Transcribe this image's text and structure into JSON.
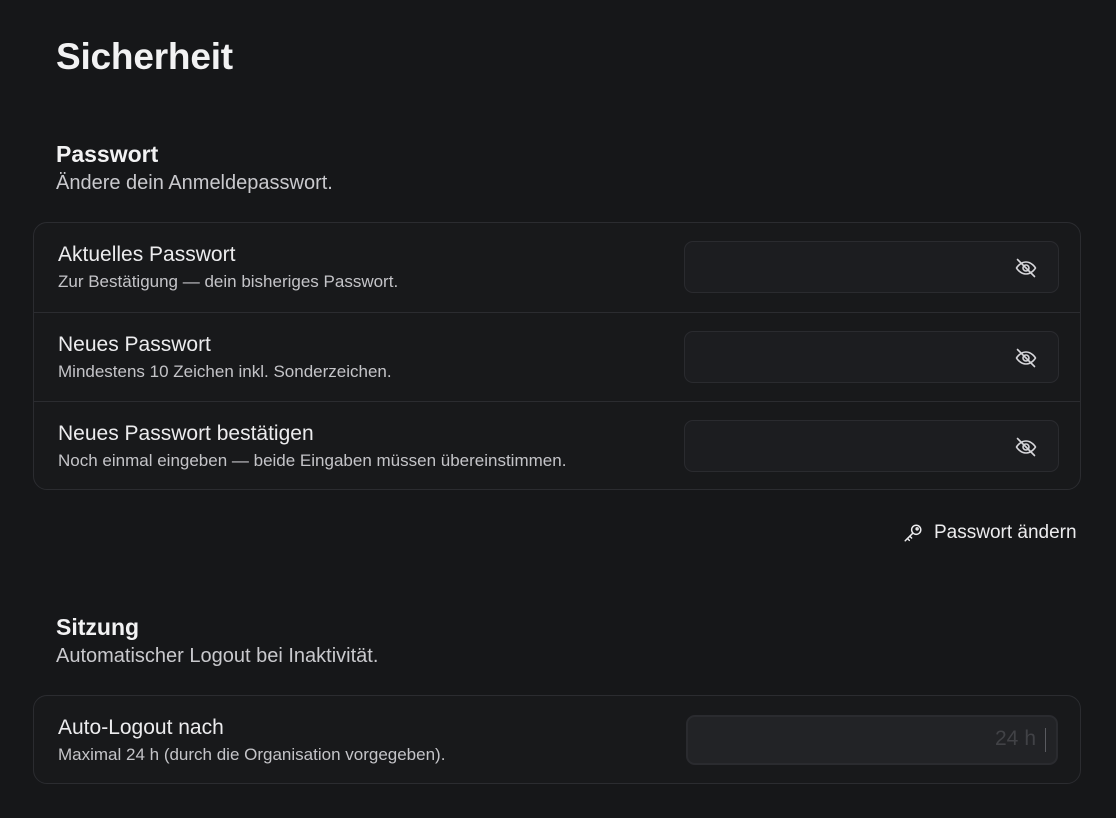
{
  "page": {
    "title": "Sicherheit"
  },
  "password_section": {
    "title": "Passwort",
    "subtitle": "Ändere dein Anmeldepasswort.",
    "rows": [
      {
        "label": "Aktuelles Passwort",
        "description": "Zur Bestätigung — dein bisheriges Passwort.",
        "value": "",
        "icon": "eye-off-icon"
      },
      {
        "label": "Neues Passwort",
        "description": "Mindestens 10 Zeichen inkl. Sonderzeichen.",
        "value": "",
        "icon": "eye-off-icon"
      },
      {
        "label": "Neues Passwort bestätigen",
        "description": "Noch einmal eingeben — beide Eingaben müssen übereinstimmen.",
        "value": "",
        "icon": "eye-off-icon"
      }
    ],
    "action": {
      "label": "Passwort ändern",
      "icon": "key-icon"
    }
  },
  "session_section": {
    "title": "Sitzung",
    "subtitle": "Automatischer Logout bei Inaktivität.",
    "rows": [
      {
        "label": "Auto-Logout nach",
        "description": "Maximal 24 h (durch die Organisation vorgegeben).",
        "value": "24",
        "unit": "h",
        "disabled": true
      }
    ]
  },
  "colors": {
    "background": "#161719",
    "card_border": "#2b2c30",
    "field_background": "#1c1d20",
    "text_primary": "#ececee",
    "text_secondary": "#c4c4c8",
    "disabled_text": "#414246"
  }
}
